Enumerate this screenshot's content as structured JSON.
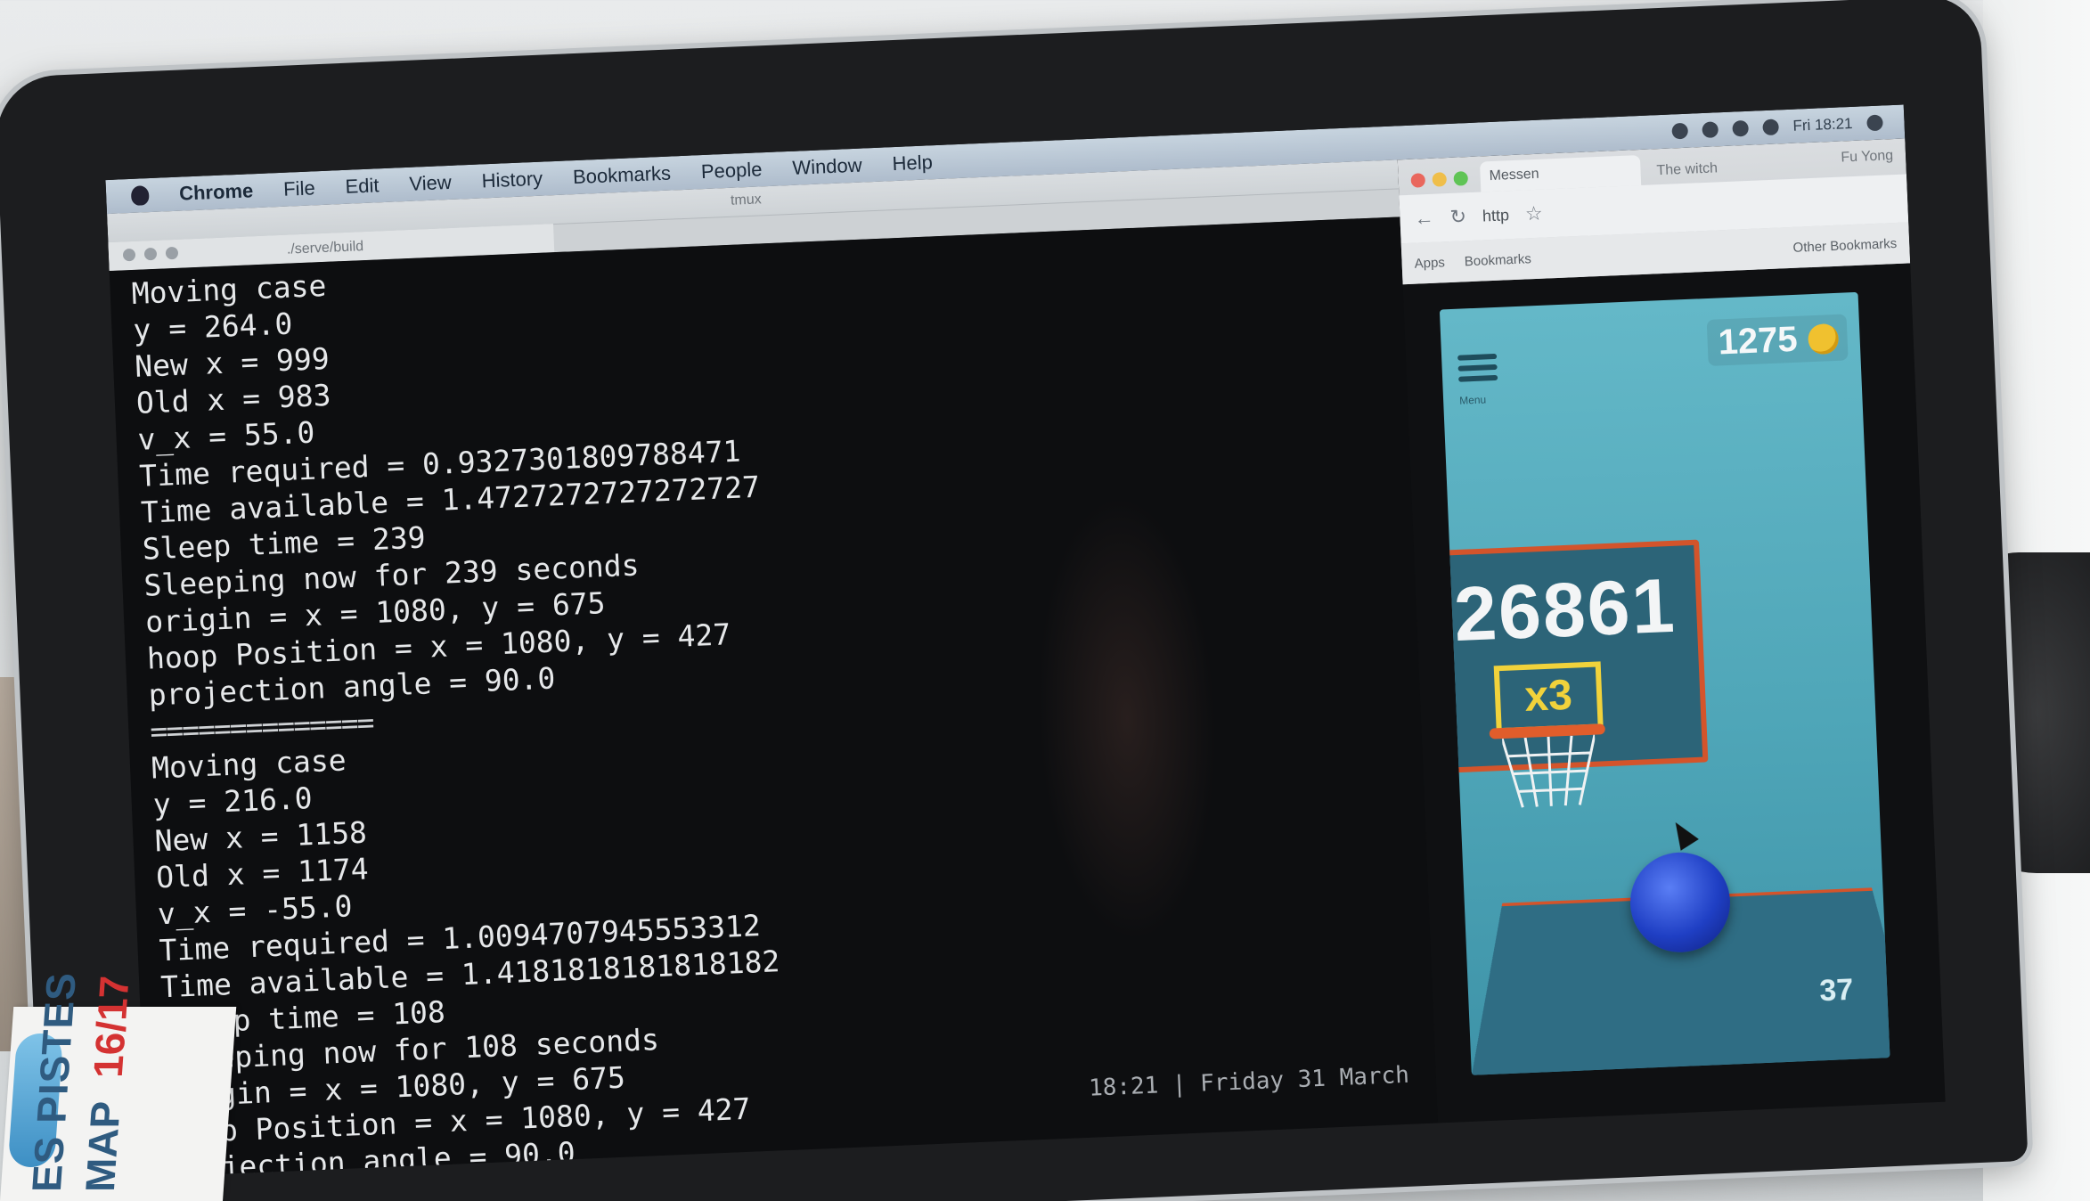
{
  "menubar": {
    "app": "Chrome",
    "items": [
      "File",
      "Edit",
      "View",
      "History",
      "Bookmarks",
      "People",
      "Window",
      "Help"
    ],
    "right_text": "Fri 18:21"
  },
  "terminal": {
    "window_title": "tmux",
    "tab_title": "./serve/build",
    "lines": [
      "Moving case",
      "y = 264.0",
      "New x = 999",
      "Old x = 983",
      "v_x = 55.0",
      "Time required = 0.9327301809788471",
      "Time available = 1.4727272727272727",
      "Sleep time = 239",
      "Sleeping now for 239 seconds",
      "origin = x = 1080, y = 675",
      "hoop Position = x = 1080, y = 427",
      "projection angle = 90.0",
      "==============",
      "Moving case",
      "y = 216.0",
      "New x = 1158",
      "Old x = 1174",
      "v_x = -55.0",
      "Time required = 1.0094707945553312",
      "Time available = 1.4181818181818182",
      "Sleep time = 108",
      "Sleeping now for 108 seconds",
      "origin = x = 1080, y = 675",
      "hoop Position = x = 1080, y = 427",
      "projection angle = 90.0"
    ],
    "status_time": "18:21 | Friday 31 March"
  },
  "browser": {
    "tab_label": "Messen",
    "tab2_label": "The witch",
    "user": "Fu Yong",
    "url": "http",
    "bookmarks": [
      "Apps",
      "Bookmarks"
    ],
    "other_bookmarks": "Other Bookmarks"
  },
  "game": {
    "menu_label": "Menu",
    "coins": "1275",
    "score": "26861",
    "multiplier": "x3",
    "shots": "37"
  },
  "magazine": {
    "line1": "ES PISTES",
    "line1_accent": "16/17",
    "line2": "MAP"
  },
  "colors": {
    "game_bg": "#4fa6b8",
    "backboard_border": "#d3542b",
    "multiplier": "#f1d23b",
    "ball": "#1f3fc4"
  }
}
